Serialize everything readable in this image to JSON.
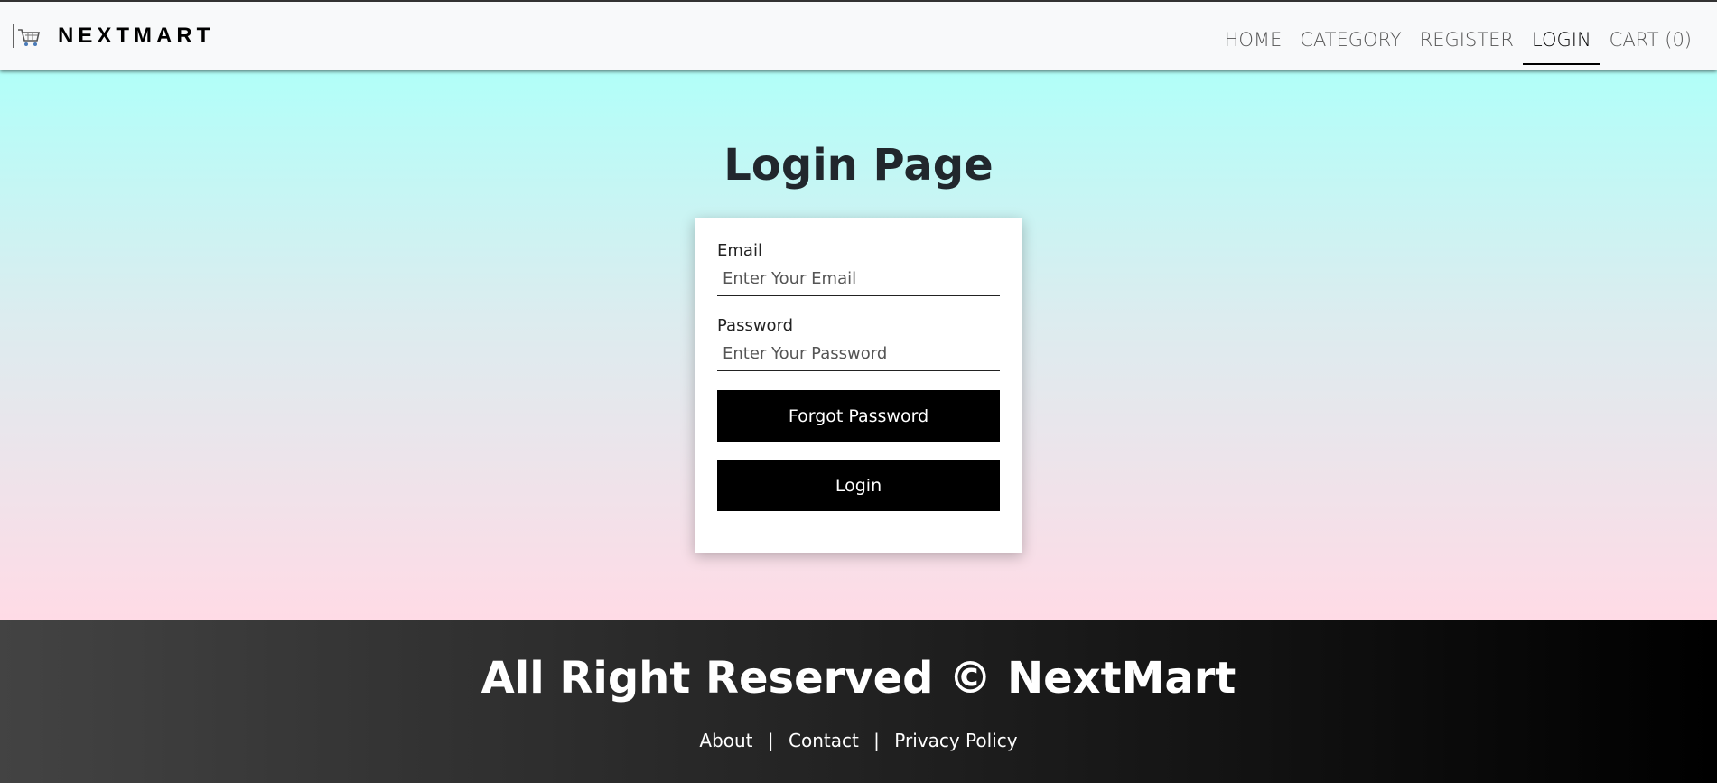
{
  "navbar": {
    "brand": "NEXTMART",
    "links": [
      {
        "label": "HOME"
      },
      {
        "label": "CATEGORY"
      },
      {
        "label": "REGISTER"
      },
      {
        "label": "LOGIN",
        "active": true
      },
      {
        "label": "CART (0)"
      }
    ]
  },
  "main": {
    "title": "Login Page",
    "form": {
      "email_label": "Email",
      "email_placeholder": "Enter Your Email",
      "email_value": "",
      "password_label": "Password",
      "password_placeholder": "Enter Your Password",
      "password_value": "",
      "forgot_label": "Forgot Password",
      "login_label": "Login"
    }
  },
  "footer": {
    "title": "All Right Reserved © NextMart",
    "links": [
      "About",
      "Contact",
      "Privacy Policy"
    ],
    "separator": "|"
  },
  "colors": {
    "gradient_top": "#b1fff9",
    "gradient_bottom": "#ffdbe6",
    "button_bg": "#000000",
    "footer_start": "#434343",
    "footer_end": "#000000"
  },
  "icons": {
    "brand": "shopping-cart-icon"
  }
}
